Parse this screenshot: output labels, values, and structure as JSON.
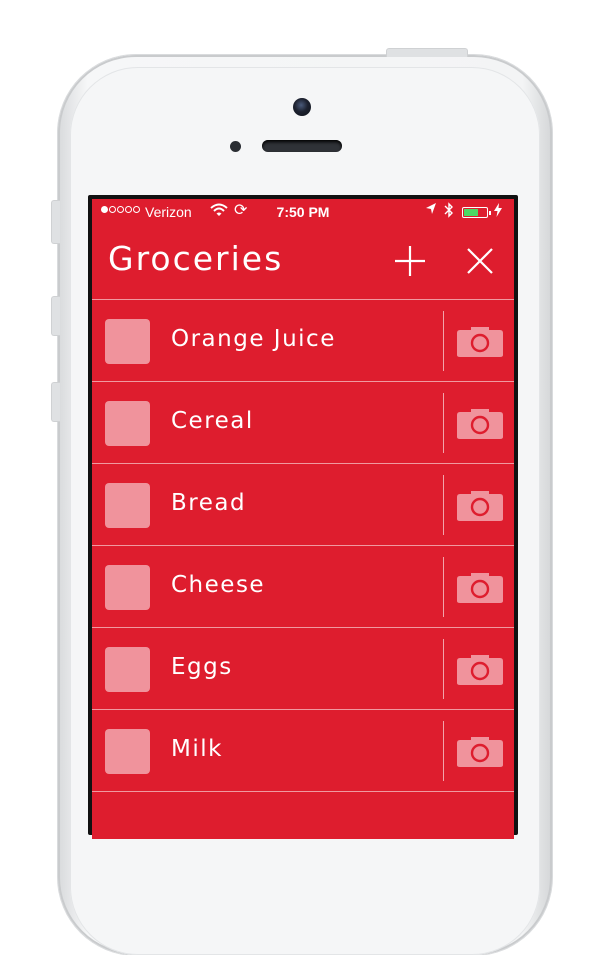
{
  "status_bar": {
    "carrier": "Verizon",
    "time": "7:50 PM",
    "signal_bars": 1,
    "signal_total": 5,
    "battery_level": 0.65,
    "icons": [
      "wifi-icon",
      "sync-icon",
      "location-icon",
      "bluetooth-icon",
      "battery-icon",
      "charging-icon"
    ]
  },
  "header": {
    "title": "Groceries",
    "add_icon": "plus-icon",
    "close_icon": "close-icon"
  },
  "items": [
    {
      "label": "Orange Juice",
      "checked": false
    },
    {
      "label": "Cereal",
      "checked": false
    },
    {
      "label": "Bread",
      "checked": false
    },
    {
      "label": "Cheese",
      "checked": false
    },
    {
      "label": "Eggs",
      "checked": false
    },
    {
      "label": "Milk",
      "checked": false
    }
  ],
  "colors": {
    "background": "#de1d2e",
    "checkbox": "#f0939c",
    "camera_icon": "#f0939c",
    "text": "#ffffff"
  }
}
